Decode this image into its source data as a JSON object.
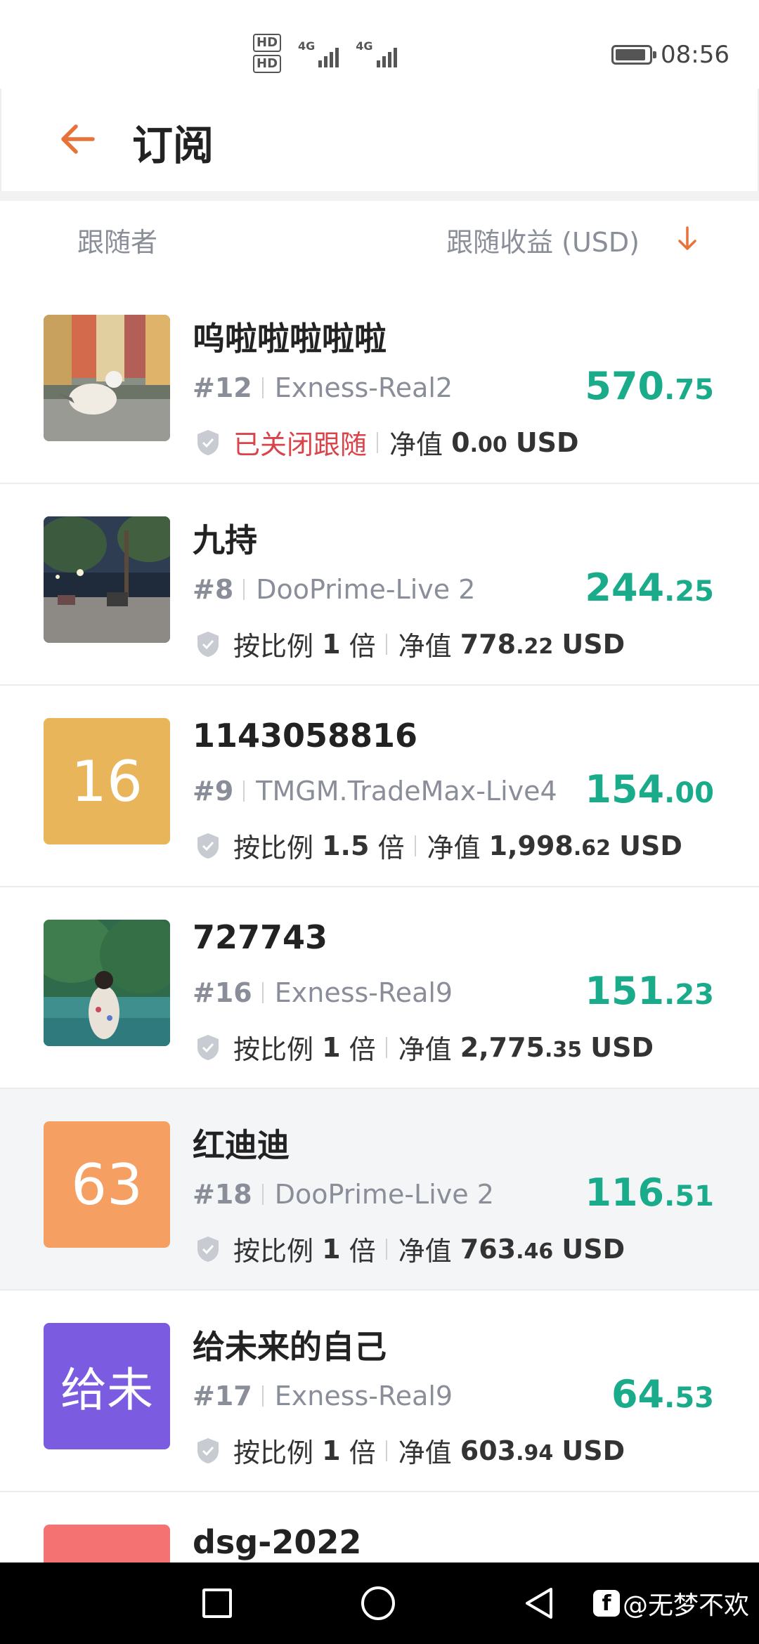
{
  "status_bar": {
    "hd1": "HD",
    "hd2": "HD",
    "sim1_label": "4G",
    "sim2_label": "4G",
    "time": "08:56"
  },
  "header": {
    "title": "订阅"
  },
  "columns": {
    "left": "跟随者",
    "right": "跟随收益 (USD)"
  },
  "colors": {
    "accent": "#e8733a",
    "profit": "#1aab8a",
    "closed": "#d9434a"
  },
  "subscribers": [
    {
      "name": "呜啦啦啦啦啦",
      "rank": "#12",
      "server": "Exness-Real2",
      "status": "已关闭跟随",
      "mode": "closed",
      "equity_label": "净值",
      "equity_int": "0",
      "equity_dec": ".00",
      "currency": "USD",
      "profit_int": "570",
      "profit_dec": ".75",
      "avatar_type": "photo-gull"
    },
    {
      "name": "九持",
      "rank": "#8",
      "server": "DooPrime-Live 2",
      "ratio_prefix": "按比例",
      "ratio": "1",
      "ratio_suffix": "倍",
      "mode": "ratio",
      "equity_label": "净值",
      "equity_int": "778",
      "equity_dec": ".22",
      "currency": "USD",
      "profit_int": "244",
      "profit_dec": ".25",
      "avatar_type": "photo-street"
    },
    {
      "name": "1143058816",
      "rank": "#9",
      "server": "TMGM.TradeMax-Live4",
      "ratio_prefix": "按比例",
      "ratio": "1.5",
      "ratio_suffix": "倍",
      "mode": "ratio",
      "equity_label": "净值",
      "equity_int": "1,998",
      "equity_dec": ".62",
      "currency": "USD",
      "profit_int": "154",
      "profit_dec": ".00",
      "avatar_text": "16",
      "avatar_color": "#e9b55a"
    },
    {
      "name": "727743",
      "rank": "#16",
      "server": "Exness-Real9",
      "ratio_prefix": "按比例",
      "ratio": "1",
      "ratio_suffix": "倍",
      "mode": "ratio",
      "equity_label": "净值",
      "equity_int": "2,775",
      "equity_dec": ".35",
      "currency": "USD",
      "profit_int": "151",
      "profit_dec": ".23",
      "avatar_type": "photo-lake"
    },
    {
      "name": "红迪迪",
      "rank": "#18",
      "server": "DooPrime-Live 2",
      "ratio_prefix": "按比例",
      "ratio": "1",
      "ratio_suffix": "倍",
      "mode": "ratio",
      "equity_label": "净值",
      "equity_int": "763",
      "equity_dec": ".46",
      "currency": "USD",
      "profit_int": "116",
      "profit_dec": ".51",
      "avatar_text": "63",
      "avatar_color": "#f5a062"
    },
    {
      "name": "给未来的自己",
      "rank": "#17",
      "server": "Exness-Real9",
      "ratio_prefix": "按比例",
      "ratio": "1",
      "ratio_suffix": "倍",
      "mode": "ratio",
      "equity_label": "净值",
      "equity_int": "603",
      "equity_dec": ".94",
      "currency": "USD",
      "profit_int": "64",
      "profit_dec": ".53",
      "avatar_text": "给未",
      "avatar_color": "#7b5ce0"
    },
    {
      "name": "dsg-2022",
      "avatar_color": "#f47272"
    }
  ],
  "watermark": {
    "logo": "f",
    "text": "@无梦不欢"
  }
}
